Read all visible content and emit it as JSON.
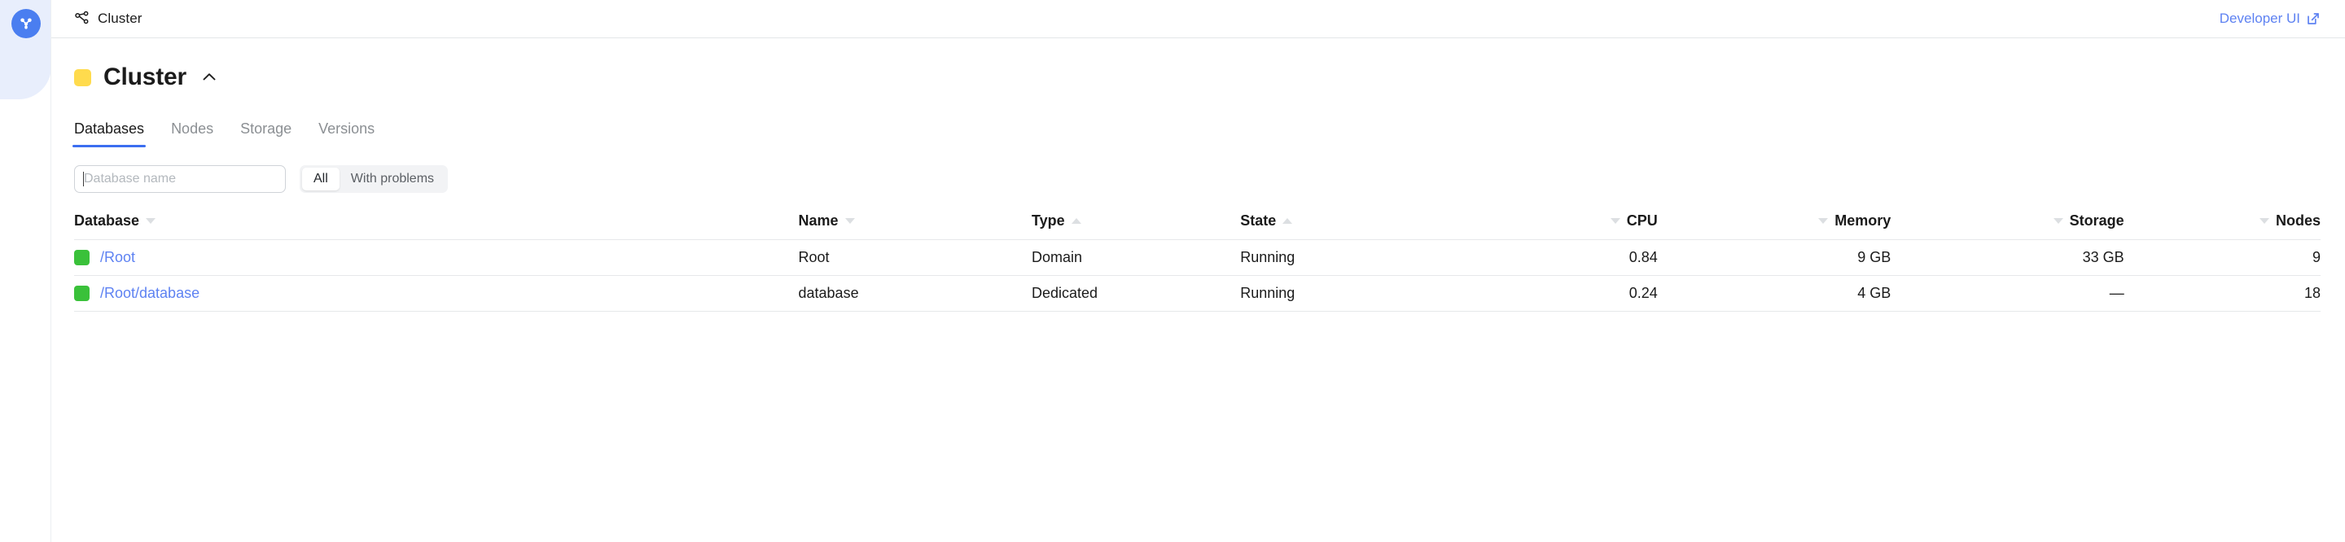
{
  "sidebar": {
    "logo_icon": "ydb-logo-icon"
  },
  "topbar": {
    "breadcrumb_icon": "cluster-nodes-icon",
    "breadcrumb_label": "Cluster",
    "developer_ui_label": "Developer UI",
    "developer_ui_icon": "external-link-icon"
  },
  "header": {
    "status_icon": "status-square-warning",
    "status_color": "#ffdb4d",
    "title": "Cluster",
    "collapse_icon": "chevron-up-icon"
  },
  "tabs": [
    {
      "label": "Databases",
      "active": true
    },
    {
      "label": "Nodes",
      "active": false
    },
    {
      "label": "Storage",
      "active": false
    },
    {
      "label": "Versions",
      "active": false
    }
  ],
  "controls": {
    "search_placeholder": "Database name",
    "search_value": "",
    "filters": [
      {
        "label": "All",
        "active": true
      },
      {
        "label": "With problems",
        "active": false
      }
    ]
  },
  "table": {
    "columns": [
      {
        "label": "Database",
        "align": "left",
        "sort": "down",
        "sort_side": "after"
      },
      {
        "label": "Name",
        "align": "left",
        "sort": "down",
        "sort_side": "after"
      },
      {
        "label": "Type",
        "align": "left",
        "sort": "up",
        "sort_side": "after"
      },
      {
        "label": "State",
        "align": "left",
        "sort": "up",
        "sort_side": "after"
      },
      {
        "label": "CPU",
        "align": "right",
        "sort": "down",
        "sort_side": "before"
      },
      {
        "label": "Memory",
        "align": "right",
        "sort": "down",
        "sort_side": "before"
      },
      {
        "label": "Storage",
        "align": "right",
        "sort": "down",
        "sort_side": "before"
      },
      {
        "label": "Nodes",
        "align": "right",
        "sort": "down",
        "sort_side": "before"
      }
    ],
    "rows": [
      {
        "status_color": "#3ac13a",
        "database": "/Root",
        "name": "Root",
        "type": "Domain",
        "state": "Running",
        "cpu": "0.84",
        "memory": "9 GB",
        "storage": "33 GB",
        "nodes": "9"
      },
      {
        "status_color": "#3ac13a",
        "database": "/Root/database",
        "name": "database",
        "type": "Dedicated",
        "state": "Running",
        "cpu": "0.24",
        "memory": "4 GB",
        "storage": "—",
        "nodes": "18"
      }
    ]
  }
}
